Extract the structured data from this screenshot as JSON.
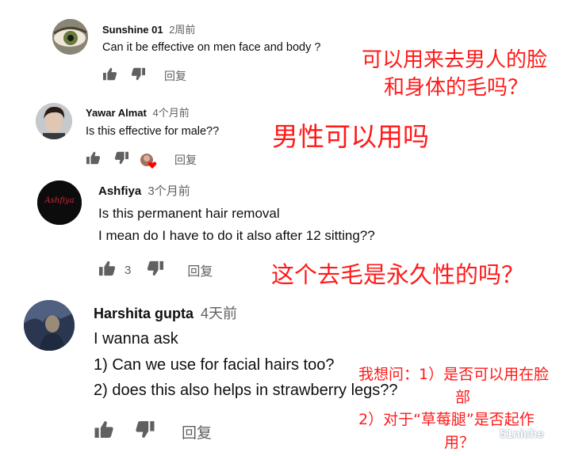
{
  "comments": [
    {
      "author": "Sunshine 01",
      "time": "2周前",
      "text": [
        "Can it be effective on men face and body ?"
      ],
      "reply_label": "回复",
      "annotation": [
        "可以用来去男人的脸",
        "和身体的毛吗？"
      ]
    },
    {
      "author": "Yawar Almat",
      "time": "4个月前",
      "text": [
        "Is this effective for male??"
      ],
      "reply_label": "回复",
      "annotation": [
        "男性可以用吗"
      ]
    },
    {
      "author": "Ashfiya",
      "time": "3个月前",
      "text": [
        "Is this permanent hair removal",
        "I mean do I have to do it also after 12 sitting??"
      ],
      "like_count": "3",
      "reply_label": "回复",
      "annotation": [
        "这个去毛是永久性的吗？"
      ],
      "avatar_text": "Ashfiya"
    },
    {
      "author": "Harshita gupta",
      "time": "4天前",
      "text": [
        "I wanna ask",
        "1) Can we use for facial hairs too?",
        "2) does this also helps in strawberry legs??"
      ],
      "reply_label": "回复",
      "annotation": [
        "我想问：1）是否可以用在脸",
        "部",
        "2）对于“草莓腿”是否起作",
        "用？"
      ]
    }
  ],
  "watermark": "51niche",
  "colors": {
    "annotation": "#ff1a1a",
    "meta": "#606060",
    "heart": "#ff0000"
  }
}
